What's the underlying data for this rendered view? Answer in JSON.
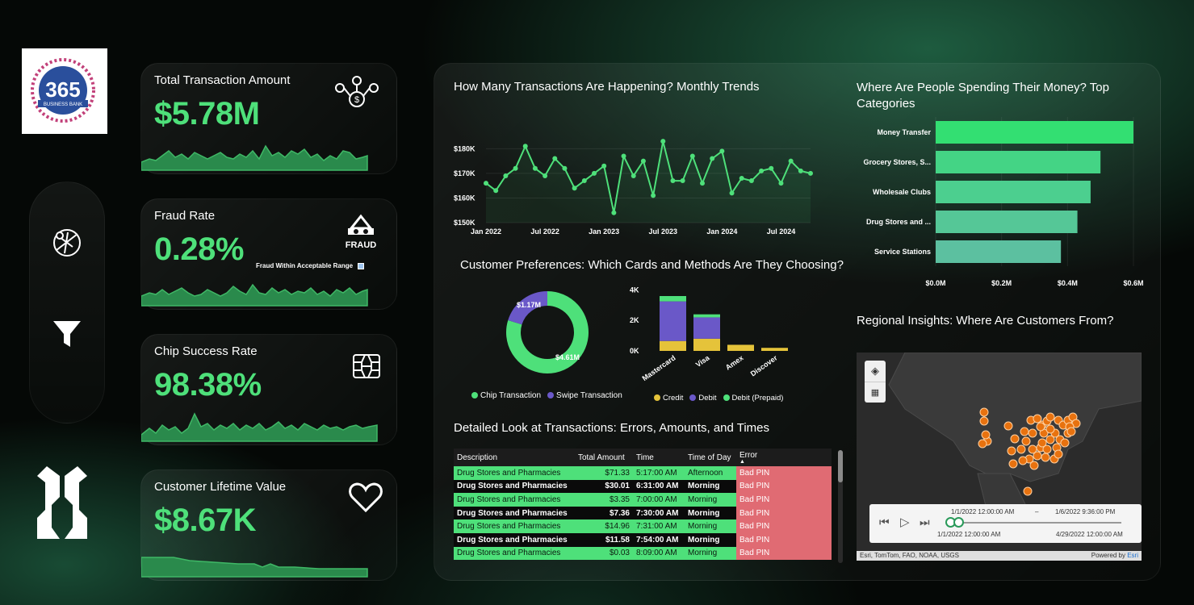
{
  "brand": {
    "logo_number": "365",
    "logo_sub": "BUSINESS BANK"
  },
  "kpis": [
    {
      "title": "Total Transaction Amount",
      "value": "$5.78M",
      "icon": "network-dollar-icon"
    },
    {
      "title": "Fraud Rate",
      "value": "0.28%",
      "icon": "fraud-mask-icon",
      "icon_text": "FRAUD",
      "note": "Fraud Within Acceptable Range"
    },
    {
      "title": "Chip Success Rate",
      "value": "98.38%",
      "icon": "chip-icon"
    },
    {
      "title": "Customer Lifetime Value",
      "value": "$8.67K",
      "icon": "heart-icon"
    }
  ],
  "nav": {
    "items": [
      "globe-icon",
      "filter-icon"
    ]
  },
  "monthly": {
    "title": "How Many Transactions Are Happening? Monthly Trends",
    "chart_data": {
      "type": "line",
      "x": [
        "Jan 2022",
        "Feb 2022",
        "Mar 2022",
        "Apr 2022",
        "May 2022",
        "Jun 2022",
        "Jul 2022",
        "Aug 2022",
        "Sep 2022",
        "Oct 2022",
        "Nov 2022",
        "Dec 2022",
        "Jan 2023",
        "Feb 2023",
        "Mar 2023",
        "Apr 2023",
        "May 2023",
        "Jun 2023",
        "Jul 2023",
        "Aug 2023",
        "Sep 2023",
        "Oct 2023",
        "Nov 2023",
        "Dec 2023",
        "Jan 2024",
        "Feb 2024",
        "Mar 2024",
        "Apr 2024",
        "May 2024",
        "Jun 2024",
        "Jul 2024",
        "Aug 2024",
        "Sep 2024",
        "Oct 2024"
      ],
      "values": [
        166,
        163,
        169,
        172,
        181,
        172,
        169,
        176,
        172,
        164,
        167,
        170,
        173,
        154,
        177,
        169,
        175,
        161,
        183,
        167,
        167,
        177,
        166,
        176,
        179,
        162,
        168,
        167,
        171,
        172,
        166,
        175,
        171,
        170
      ],
      "xticks": [
        "Jan 2022",
        "Jul 2022",
        "Jan 2023",
        "Jul 2023",
        "Jan 2024",
        "Jul 2024"
      ],
      "yticks": [
        "$150K",
        "$160K",
        "$170K",
        "$180K"
      ],
      "ylim": [
        150,
        186
      ],
      "color": "#4ee07a"
    }
  },
  "categories": {
    "title": "Where Are People Spending Their Money? Top Categories",
    "chart_data": {
      "type": "bar",
      "categories": [
        "Money Transfer",
        "Grocery Stores, S...",
        "Wholesale Clubs",
        "Drug Stores and ...",
        "Service Stations"
      ],
      "values": [
        0.6,
        0.5,
        0.47,
        0.43,
        0.38
      ],
      "xticks": [
        "$0.0M",
        "$0.2M",
        "$0.4M",
        "$0.6M"
      ],
      "xlim": [
        0,
        0.6
      ],
      "colors": [
        "#33df72",
        "#44d485",
        "#4ccf8f",
        "#55c797",
        "#5cc0a0"
      ]
    }
  },
  "preferences": {
    "title": "Customer Preferences: Which Cards and Methods Are They Choosing?",
    "donut": {
      "type": "pie",
      "labels": [
        "Chip Transaction",
        "Swipe Transaction"
      ],
      "values": [
        4.61,
        1.17
      ],
      "value_labels": [
        "$4.61M",
        "$1.17M"
      ],
      "colors": [
        "#4ee07a",
        "#6a58c8"
      ]
    },
    "stacked": {
      "type": "bar",
      "categories": [
        "Mastercard",
        "Visa",
        "Amex",
        "Discover"
      ],
      "series": [
        {
          "name": "Credit",
          "values": [
            650,
            800,
            400,
            200
          ]
        },
        {
          "name": "Debit",
          "values": [
            2600,
            1400,
            0,
            0
          ]
        },
        {
          "name": "Debit (Prepaid)",
          "values": [
            350,
            200,
            0,
            0
          ]
        }
      ],
      "yticks": [
        "0K",
        "2K",
        "4K"
      ],
      "ylim": [
        0,
        4500
      ],
      "colors": [
        "#e5c33a",
        "#6a58c8",
        "#4ee07a"
      ]
    }
  },
  "table": {
    "title": "Detailed Look at Transactions: Errors, Amounts, and Times",
    "columns": [
      "Description",
      "Total Amount",
      "Time",
      "Time of Day",
      "Error"
    ],
    "rows": [
      [
        "Drug Stores and Pharmacies",
        "$71.33",
        "5:17:00 AM",
        "Afternoon",
        "Bad PIN"
      ],
      [
        "Drug Stores and Pharmacies",
        "$30.01",
        "6:31:00 AM",
        "Morning",
        "Bad PIN"
      ],
      [
        "Drug Stores and Pharmacies",
        "$3.35",
        "7:00:00 AM",
        "Morning",
        "Bad PIN"
      ],
      [
        "Drug Stores and Pharmacies",
        "$7.36",
        "7:30:00 AM",
        "Morning",
        "Bad PIN"
      ],
      [
        "Drug Stores and Pharmacies",
        "$14.96",
        "7:31:00 AM",
        "Morning",
        "Bad PIN"
      ],
      [
        "Drug Stores and Pharmacies",
        "$11.58",
        "7:54:00 AM",
        "Morning",
        "Bad PIN"
      ],
      [
        "Drug Stores and Pharmacies",
        "$0.03",
        "8:09:00 AM",
        "Morning",
        "Bad PIN"
      ]
    ]
  },
  "map": {
    "title": "Regional Insights: Where Are Customers From?",
    "time_start": "1/1/2022  12:00:00 AM",
    "time_sep": "–",
    "time_end": "1/6/2022  9:36:00 PM",
    "range_start": "1/1/2022  12:00:00 AM",
    "range_end": "4/29/2022  12:00:00 AM",
    "attribution": "Esri, TomTom, FAO, NOAA, USGS",
    "powered_by": "Powered by",
    "powered_brand": "Esri",
    "dot_color": "#e8720f"
  }
}
